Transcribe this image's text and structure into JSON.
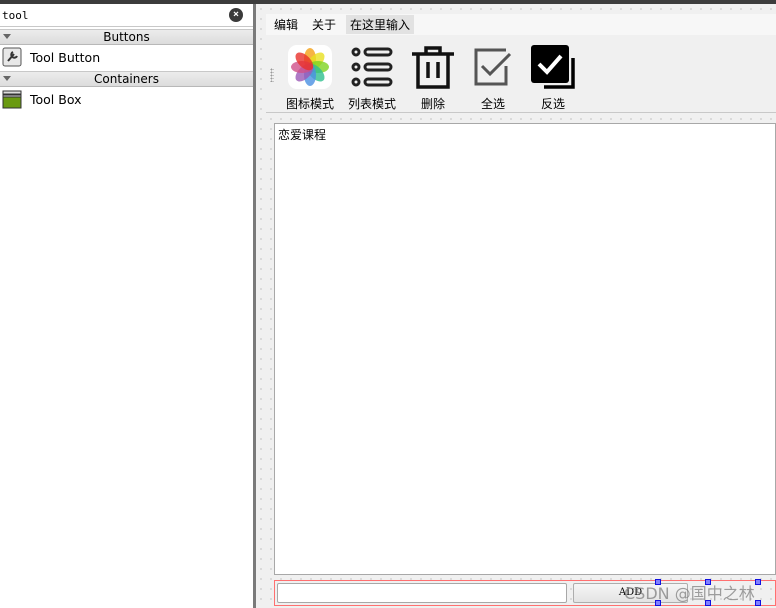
{
  "widget_box": {
    "search_value": "tool",
    "categories": [
      {
        "label": "Buttons",
        "items": [
          {
            "label": "Tool Button",
            "icon": "tool-button-icon"
          }
        ]
      },
      {
        "label": "Containers",
        "items": [
          {
            "label": "Tool Box",
            "icon": "tool-box-icon"
          }
        ]
      }
    ]
  },
  "menubar": {
    "items": [
      "编辑",
      "关于"
    ],
    "type_here": "在这里输入"
  },
  "toolbar": {
    "buttons": [
      {
        "label": "图标模式",
        "icon": "photos-icon"
      },
      {
        "label": "列表模式",
        "icon": "list-icon"
      },
      {
        "label": "删除",
        "icon": "trash-icon"
      },
      {
        "label": "全选",
        "icon": "checkbox-icon"
      },
      {
        "label": "反选",
        "icon": "checkbox-inverted-icon"
      }
    ]
  },
  "list": {
    "items": [
      "恋爱课程"
    ]
  },
  "bottom": {
    "input_value": "",
    "add_label": "ADD"
  },
  "watermark": "CSDN @国中之林"
}
